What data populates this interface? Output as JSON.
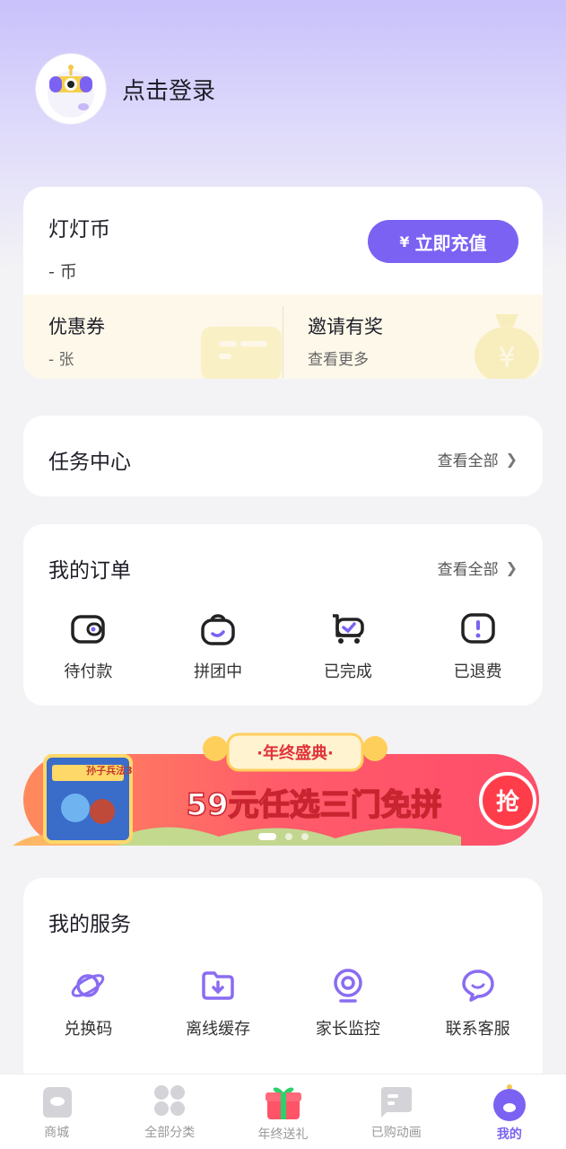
{
  "header": {
    "login_text": "点击登录"
  },
  "coin": {
    "title": "灯灯币",
    "value": "- 币",
    "recharge_button": "立即充值",
    "yen_symbol": "¥",
    "coupon": {
      "title": "优惠券",
      "value": "- 张"
    },
    "invite": {
      "title": "邀请有奖",
      "value": "查看更多"
    }
  },
  "task_center": {
    "title": "任务中心",
    "see_all": "查看全部"
  },
  "orders": {
    "title": "我的订单",
    "see_all": "查看全部",
    "items": [
      {
        "label": "待付款",
        "icon": "wallet-icon"
      },
      {
        "label": "拼团中",
        "icon": "group-bag-icon"
      },
      {
        "label": "已完成",
        "icon": "cart-check-icon"
      },
      {
        "label": "已退费",
        "icon": "refund-alert-icon"
      }
    ]
  },
  "banner": {
    "badge": "·年终盛典·",
    "headline": "59元任选三门免拼",
    "cta": "抢",
    "book_title": "孙子兵法3",
    "slides": 3,
    "active_slide": 1
  },
  "services": {
    "title": "我的服务",
    "items": [
      {
        "label": "兑换码",
        "icon": "planet-icon"
      },
      {
        "label": "离线缓存",
        "icon": "download-folder-icon"
      },
      {
        "label": "家长监控",
        "icon": "camera-icon"
      },
      {
        "label": "联系客服",
        "icon": "chat-icon"
      }
    ]
  },
  "tabbar": {
    "items": [
      {
        "label": "商城",
        "icon": "shop-icon"
      },
      {
        "label": "全部分类",
        "icon": "category-icon"
      },
      {
        "label": "年终送礼",
        "icon": "gift-icon"
      },
      {
        "label": "已购动画",
        "icon": "purchased-icon"
      },
      {
        "label": "我的",
        "icon": "profile-icon",
        "active": true
      }
    ]
  },
  "colors": {
    "accent": "#7b62f3",
    "banner_red": "#ff4d5a",
    "coin_bg": "#fdf8e9"
  }
}
